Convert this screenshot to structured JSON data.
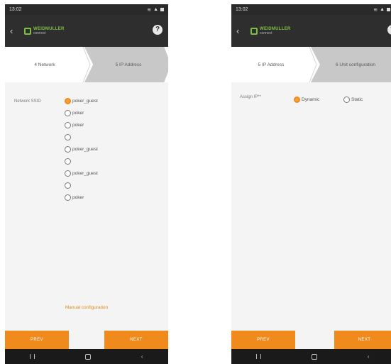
{
  "left": {
    "status": {
      "time": "13:02"
    },
    "logo": {
      "line1": "WEIDMULLER",
      "line2": "connect"
    },
    "steps": {
      "step_current": "4 Network",
      "step_next": "5 IP Address"
    },
    "field_label": "Network SSID",
    "networks": [
      {
        "label": "poker_guest",
        "selected": true
      },
      {
        "label": "poker",
        "selected": false
      },
      {
        "label": "poker",
        "selected": false
      },
      {
        "label": "",
        "selected": false
      },
      {
        "label": "poker_guest",
        "selected": false
      },
      {
        "label": "",
        "selected": false
      },
      {
        "label": "poker_guest",
        "selected": false
      },
      {
        "label": "",
        "selected": false
      },
      {
        "label": "poker",
        "selected": false
      }
    ],
    "manual_link": "Manual configuration",
    "prev_label": "PREV",
    "next_label": "NEXT"
  },
  "right": {
    "status": {
      "time": "13:02"
    },
    "logo": {
      "line1": "WEIDMULLER",
      "line2": "connect"
    },
    "steps": {
      "step_current": "5 IP Address",
      "step_next": "6 Unit configuration"
    },
    "field_label": "Assign IP**",
    "options": [
      {
        "label": "Dynamic",
        "selected": true
      },
      {
        "label": "Static",
        "selected": false
      }
    ],
    "prev_label": "PREV",
    "next_label": "NEXT"
  },
  "accent_color": "#f08a1c",
  "icons": [
    "back-arrow-icon",
    "help-icon",
    "wifi-icon",
    "signal-icon",
    "battery-icon",
    "recent-apps-icon",
    "home-icon",
    "back-nav-icon"
  ]
}
